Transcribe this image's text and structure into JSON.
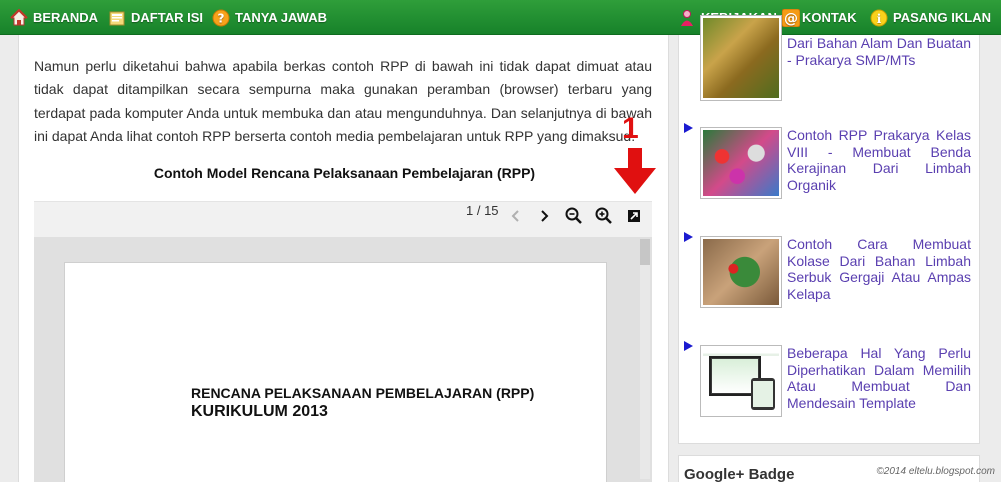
{
  "nav": {
    "left": [
      {
        "label": "BERANDA",
        "icon": "home-icon"
      },
      {
        "label": "DAFTAR ISI",
        "icon": "folder-icon"
      },
      {
        "label": "TANYA JAWAB",
        "icon": "question-icon"
      }
    ],
    "right": [
      {
        "label": "KEBIJAKAN",
        "icon": "person-icon"
      },
      {
        "label": "KONTAK",
        "icon": "at-icon"
      },
      {
        "label": "PASANG IKLAN",
        "icon": "info-icon"
      }
    ]
  },
  "article": {
    "paragraph": "Namun perlu diketahui bahwa apabila berkas contoh RPP di bawah ini tidak dapat dimuat atau tidak dapat ditampilkan secara sempurna maka gunakan peramban (browser) terbaru yang terdapat pada komputer Anda untuk membuka dan atau mengunduhnya. Dan selanjutnya di bawah ini dapat Anda lihat contoh RPP berserta contoh media pembelajaran untuk RPP yang dimaksud.",
    "doc_title": "Contoh Model Rencana Pelaksanaan Pembelajaran (RPP)"
  },
  "viewer": {
    "page_count": "1 / 15",
    "page_heading_1": "RENCANA PELAKSANAAN PEMBELAJARAN (RPP)",
    "page_heading_2": "KURIKULUM 2013"
  },
  "annotation": {
    "number": "1",
    "color": "#e01010"
  },
  "sidebar": {
    "items": [
      {
        "title": "Dari Bahan Alam Dan Buatan - Prakarya SMP/MTs"
      },
      {
        "title": "Contoh RPP Prakarya Kelas VIII - Membuat Benda Kerajinan Dari Limbah Organik"
      },
      {
        "title": "Contoh Cara Membuat Kolase Dari Bahan Limbah Serbuk Gergaji Atau Ampas Kelapa"
      },
      {
        "title": "Beberapa Hal Yang Perlu Diperhatikan Dalam Memilih Atau Membuat Dan Mendesain Template"
      }
    ],
    "badge_title": "Google+ Badge"
  },
  "watermark": "©2014 eltelu.blogspot.com",
  "colors": {
    "nav_green": "#17822a",
    "link_purple": "#5a3fb0",
    "arrow_blue": "#1b1bd0"
  }
}
